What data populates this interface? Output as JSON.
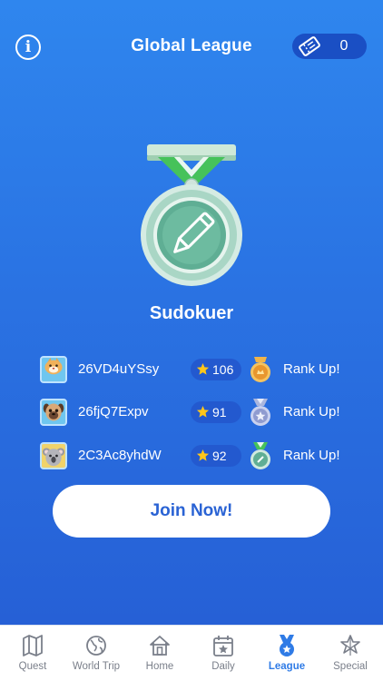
{
  "header": {
    "info_icon": "info-circle-icon",
    "info_glyph": "i",
    "title": "Global League",
    "ticket_icon": "ticket-icon",
    "ticket_count": "0"
  },
  "league": {
    "medal_icon": "green-medal-pencil-icon",
    "name": "Sudokuer"
  },
  "players": [
    {
      "name": "26VD4uYSsy",
      "avatar": "cat-avatar-icon",
      "score": "106",
      "badge": "gold-badge-icon",
      "status": "Rank Up!"
    },
    {
      "name": "26fjQ7Expv",
      "avatar": "pug-avatar-icon",
      "score": "91",
      "badge": "silver-badge-icon",
      "status": "Rank Up!"
    },
    {
      "name": "2C3Ac8yhdW",
      "avatar": "koala-avatar-icon",
      "score": "92",
      "badge": "green-badge-icon",
      "status": "Rank Up!"
    }
  ],
  "join_button": "Join Now!",
  "tabs": [
    {
      "label": "Quest",
      "icon": "map-icon",
      "active": false
    },
    {
      "label": "World Trip",
      "icon": "globe-icon",
      "active": false
    },
    {
      "label": "Home",
      "icon": "home-icon",
      "active": false
    },
    {
      "label": "Daily",
      "icon": "calendar-star-icon",
      "active": false
    },
    {
      "label": "League",
      "icon": "medal-icon",
      "active": true
    },
    {
      "label": "Special",
      "icon": "snowflake-star-icon",
      "active": false
    }
  ],
  "colors": {
    "background_top": "#2f86ee",
    "background_bottom": "#2660d6",
    "accent": "#2f7be6",
    "medal_green": "#5fae94",
    "ribbon_green": "#46c25a"
  }
}
